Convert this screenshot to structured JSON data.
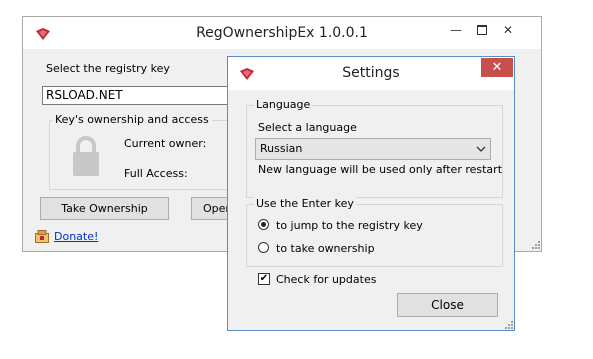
{
  "main_window": {
    "title": "RegOwnershipEx 1.0.0.1",
    "min_glyph": "—",
    "close_glyph": "✕",
    "select_key_label": "Select the registry key",
    "key_value": "RSLOAD.NET",
    "group_caption": "Key's ownership and access",
    "current_owner_label": "Current owner:",
    "full_access_label": "Full Access:",
    "take_ownership_label": "Take Ownership",
    "open_label": "Oper",
    "donate_label": "Donate!"
  },
  "settings": {
    "title": "Settings",
    "close_glyph": "✕",
    "language_group": "Language",
    "select_language_label": "Select a language",
    "selected_language": "Russian",
    "restart_note": "New language will be used only after restart",
    "enter_group": "Use the Enter key",
    "radio_options": [
      "to jump to the registry key",
      "to take ownership"
    ],
    "selected_radio": 0,
    "check_updates_label": "Check for updates",
    "check_updates_checked": true,
    "check_mark": "✔",
    "close_button_label": "Close"
  },
  "icons": [
    "app-icon",
    "lock-icon",
    "donate-icon",
    "chevron-down-icon",
    "resize-grip-icon"
  ],
  "colors": {
    "close_red": "#c7504b",
    "link_blue": "#0033cc",
    "dialog_border": "#5b8dc5"
  }
}
